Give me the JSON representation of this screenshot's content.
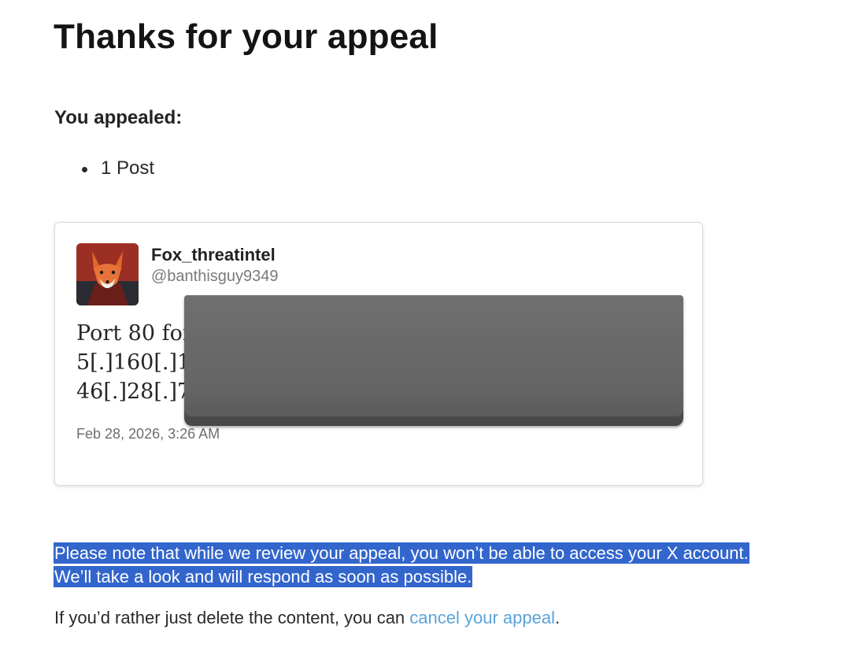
{
  "page": {
    "title": "Thanks for your appeal"
  },
  "appealed": {
    "heading": "You appealed:",
    "items": [
      "1 Post"
    ]
  },
  "post": {
    "display_name": "Fox_threatintel",
    "handle": "@banthisguy9349",
    "text_lines": [
      "Port 80 for",
      "5[.]160[.]1",
      "46[.]28[.]7"
    ],
    "timestamp": "Feb 28, 2026, 3:26 AM",
    "avatar_icon": "fox-avatar-icon",
    "redaction_color": "#666666"
  },
  "notice": {
    "line1": "Please note that while we review your appeal, you won’t be able to access your X account.",
    "line2": "We’ll take a look and will respond as soon as possible.",
    "highlight_color": "#3366cc"
  },
  "cancel": {
    "prefix": "If you’d rather just delete the content, you can ",
    "link_text": "cancel your appeal",
    "suffix": ".",
    "link_color": "#5aa3d9"
  }
}
